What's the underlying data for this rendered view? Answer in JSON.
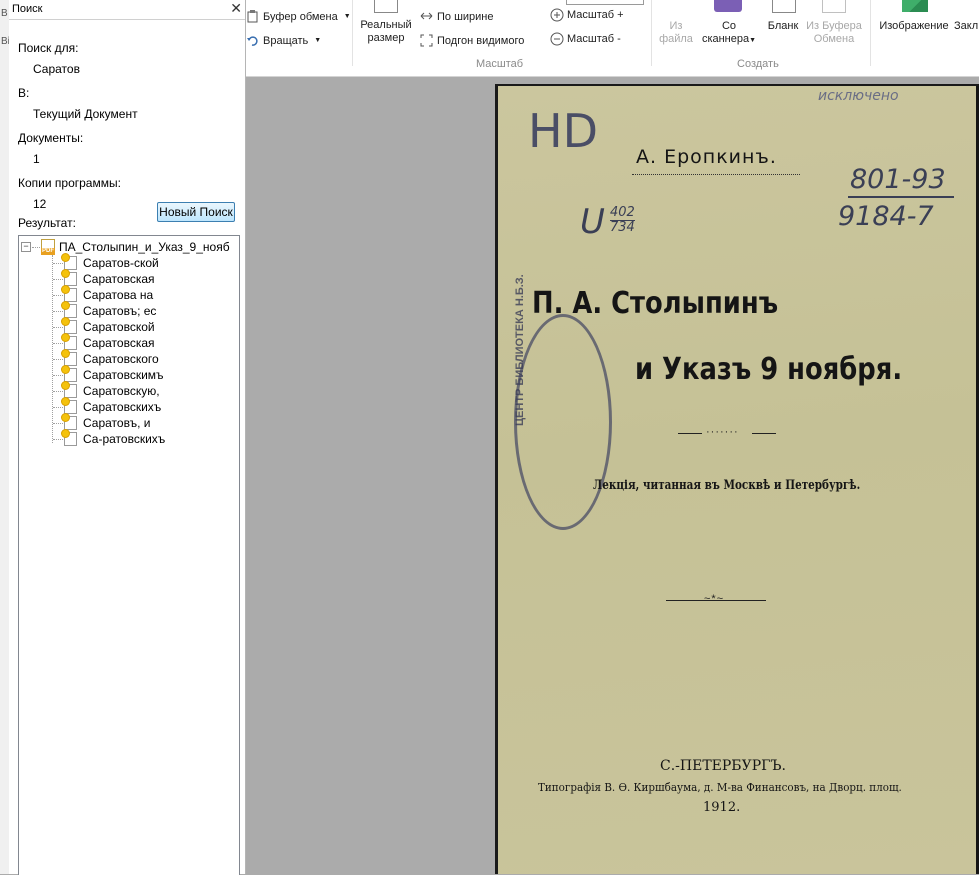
{
  "ribbon": {
    "clipboard_label": "Буфер обмена",
    "rotate_label": "Вращать",
    "actual_size_line1": "Реальный",
    "actual_size_line2": "размер",
    "fit_width_label": "По ширине",
    "fit_visible_label": "Подгон видимого",
    "zoom_in_label": "Масштаб +",
    "zoom_out_label": "Масштаб -",
    "group_zoom": "Масштаб",
    "from_file_line1": "Из",
    "from_file_line2": "файла",
    "from_scanner_line1": "Со",
    "from_scanner_line2": "сканнера",
    "blank_label": "Бланк",
    "from_clipboard_line1": "Из Буфера",
    "from_clipboard_line2": "Обмена",
    "group_create": "Создать",
    "image_label": "Изображение",
    "bookmark_label": "Закл"
  },
  "edge": {
    "letter1": "В",
    "letter2": "Ві"
  },
  "search": {
    "title": "Поиск",
    "find_label": "Поиск для:",
    "find_value": "Саратов",
    "in_label": "В:",
    "in_value": "Текущий Документ",
    "docs_label": "Документы:",
    "docs_value": "1",
    "copies_label": "Копии программы:",
    "copies_value": "12",
    "new_search_button": "Новый Поиск",
    "result_label": "Результат:",
    "root_item": "ПА_Столыпин_и_Указ_9_нояб",
    "results": [
      "Саратов-ской",
      "Саратовская",
      "Саратова на",
      "Саратовъ; ес",
      "Саратовской",
      "Саратовская",
      "Саратовского",
      "Саратовскимъ",
      "Саратовскую,",
      "Саратовскихъ",
      "Саратовъ, и",
      "Са-ратовскихъ"
    ]
  },
  "document": {
    "author": "А. Еропкинъ.",
    "title_line1": "П. А. Столыпинъ",
    "title_line2": "и Указъ 9 ноября.",
    "subtitle": "Лекція, читанная въ Москвѣ и Петербургѣ.",
    "city": "С.-ПЕТЕРБУРГЪ.",
    "printer": "Типографія В. Ѳ. Киршбаума, д. М-ва Финансовъ, на Дворц. площ.",
    "year": "1912.",
    "handwriting_hd": "HD",
    "handwriting_num1": "801-93",
    "handwriting_num2": "9184-7",
    "handwriting_shelf_u": "U",
    "handwriting_shelf_top": "402",
    "handwriting_shelf_bottom": "734",
    "handwriting_top": "исключено",
    "stamp_text": "ЦЕНТР БИБЛИОТЕКА Н.Б.З."
  }
}
